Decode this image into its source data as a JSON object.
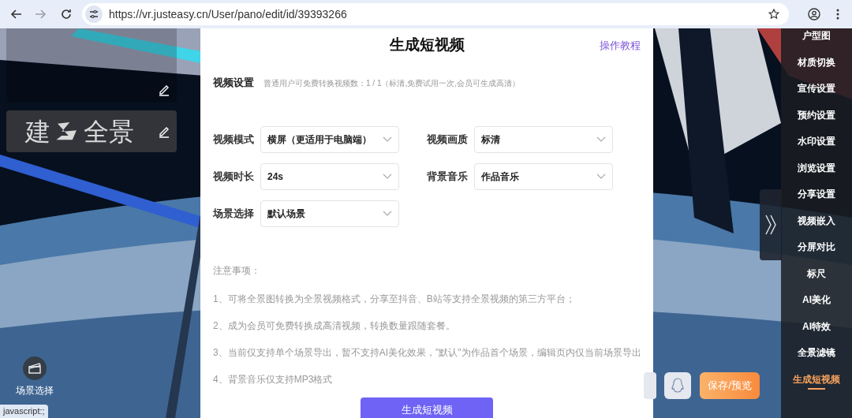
{
  "browser": {
    "nav_buttons": [
      {
        "kind": "back",
        "disabled": false
      },
      {
        "kind": "forward",
        "disabled": true
      },
      {
        "kind": "reload",
        "disabled": false
      }
    ],
    "url": "https://vr.justeasy.cn/User/pano/edit/id/39393266",
    "status_text": "javascript:;"
  },
  "left_panel": {
    "logo": {
      "text_left": "建",
      "text_right": "全景"
    },
    "scene_button": {
      "label": "场景选择"
    }
  },
  "modal": {
    "title": "生成短视频",
    "help_link": "操作教程",
    "settings": {
      "label": "视频设置",
      "note": "普通用户可免费转换视频数：1 / 1（标清,免费试用一次,会员可生成高清）"
    },
    "fields": [
      {
        "label": "视频模式",
        "value": "横屏（更适用于电脑端）"
      },
      {
        "label": "视频画质",
        "value": "标清"
      },
      {
        "label": "视频时长",
        "value": "24s"
      },
      {
        "label": "背景音乐",
        "value": "作品音乐"
      },
      {
        "label": "场景选择",
        "value": "默认场景"
      }
    ],
    "notes_title": "注意事项：",
    "notes": [
      "1、可将全景图转换为全景视频格式，分享至抖音、B站等支持全景视频的第三方平台；",
      "2、成为会员可免费转换成高清视频，转换数量跟随套餐。",
      "3、当前仅支持单个场景导出，暂不支持AI美化效果，\"默认\"为作品首个场景，编辑页内仅当前场景导出",
      "4、背景音乐仅支持MP3格式"
    ],
    "submit": "生成短视频"
  },
  "right_menu": {
    "items": [
      {
        "label": "户型图",
        "selected": false
      },
      {
        "label": "材质切换",
        "selected": false
      },
      {
        "label": "宣传设置",
        "selected": false
      },
      {
        "label": "预约设置",
        "selected": false
      },
      {
        "label": "水印设置",
        "selected": false
      },
      {
        "label": "浏览设置",
        "selected": false
      },
      {
        "label": "分享设置",
        "selected": false
      },
      {
        "label": "视频嵌入",
        "selected": false
      },
      {
        "label": "分屏对比",
        "selected": false
      },
      {
        "label": "标尺",
        "selected": false
      },
      {
        "label": "AI美化",
        "selected": false
      },
      {
        "label": "AI特效",
        "selected": false
      },
      {
        "label": "全景滤镜",
        "selected": false
      },
      {
        "label": "生成短视频",
        "selected": true
      }
    ]
  },
  "bottom_bar": {
    "save_button": "保存/预览"
  }
}
